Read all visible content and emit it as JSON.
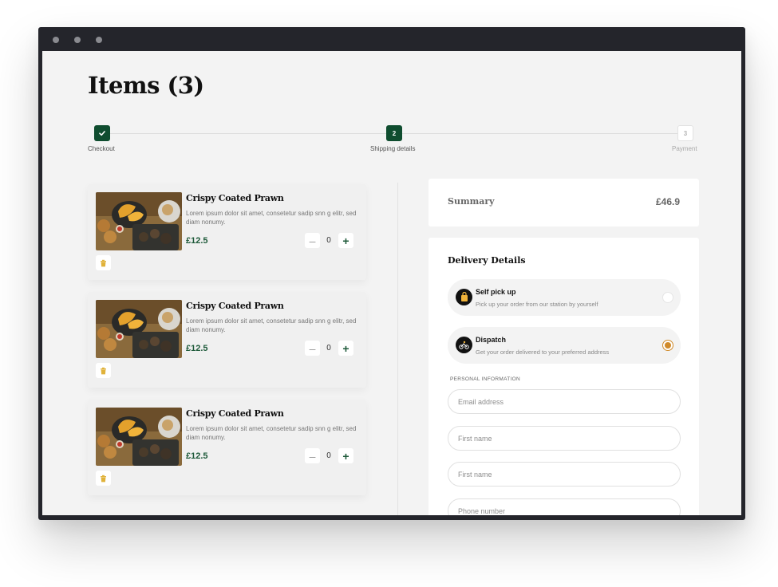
{
  "window": {
    "dot_color": "#8a8b90",
    "frame_color": "#24252b"
  },
  "page": {
    "title": "Items (3)"
  },
  "stepper": {
    "steps": [
      {
        "label": "Checkout",
        "number": "",
        "state": "done"
      },
      {
        "label": "Shipping details",
        "number": "2",
        "state": "active"
      },
      {
        "label": "Payment",
        "number": "3",
        "state": "todo"
      }
    ]
  },
  "cart": {
    "items": [
      {
        "name": "Crispy Coated Prawn",
        "description": "Lorem ipsum dolor sit amet, consetetur sadip snn g elitr, sed diam nonumy.",
        "price": "£12.5",
        "quantity": "0"
      },
      {
        "name": "Crispy Coated Prawn",
        "description": "Lorem ipsum dolor sit amet, consetetur sadip snn g elitr, sed diam nonumy.",
        "price": "£12.5",
        "quantity": "0"
      },
      {
        "name": "Crispy Coated Prawn",
        "description": "Lorem ipsum dolor sit amet, consetetur sadip snn g elitr, sed diam nonumy.",
        "price": "£12.5",
        "quantity": "0"
      }
    ],
    "minus_symbol": "–",
    "plus_symbol": "+"
  },
  "summary": {
    "label": "Summary",
    "total": "£46.9"
  },
  "delivery": {
    "title": "Delivery Details",
    "options": [
      {
        "title": "Self pick up",
        "subtitle": "Pick up your order from our station by yourself",
        "selected": false
      },
      {
        "title": "Dispatch",
        "subtitle": "Get your order delivered to your preferred address",
        "selected": true
      }
    ],
    "personal_info_label": "PERSONAL INFORMATION",
    "fields": [
      {
        "placeholder": "Email address",
        "value": ""
      },
      {
        "placeholder": "First name",
        "value": ""
      },
      {
        "placeholder": "First name",
        "value": ""
      },
      {
        "placeholder": "Phone number",
        "value": ""
      }
    ]
  },
  "colors": {
    "accent": "#0f4d2f",
    "price": "#1e5a3a",
    "radio_selected": "#d08a2a",
    "background": "#f3f3f3"
  }
}
